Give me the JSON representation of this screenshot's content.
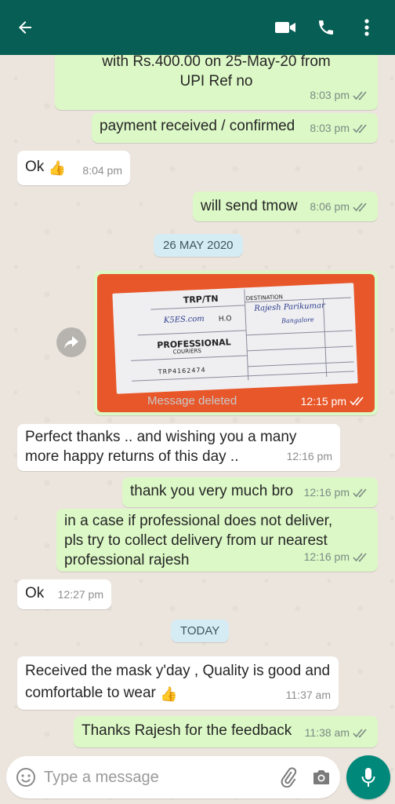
{
  "header": {
    "back_icon": "arrow-left-icon",
    "video_icon": "video-call-icon",
    "call_icon": "phone-icon",
    "menu_icon": "more-vertical-icon",
    "bg_color": "#075e54"
  },
  "messages": {
    "m1": {
      "line1": "with Rs.400.00 on 25-May-20 from",
      "line2": "UPI Ref no",
      "time": "8:03 pm"
    },
    "m2": {
      "text": "payment received / confirmed",
      "time": "8:03 pm"
    },
    "m3": {
      "text": "Ok",
      "emoji": "👍",
      "time": "8:04 pm"
    },
    "m4": {
      "text": "will send tmow",
      "time": "8:06 pm"
    },
    "day1": "26 MAY 2020",
    "m5": {
      "deleted_label": "Message deleted",
      "time": "12:15 pm",
      "receipt": {
        "brand": "PROFESSIONAL",
        "sub": "COURIERS",
        "code": "TRP/TN",
        "dest": "DESTINATION",
        "handwritten_from": "K5ES.com",
        "handwritten_to": "Rajesh Parikumar",
        "city": "Bangalore",
        "ho": "H.O",
        "tracking": "TRP4162474"
      }
    },
    "m6": {
      "line1": "Perfect thanks .. and wishing you a many",
      "line2": "more happy returns of this day ..",
      "time": "12:16 pm"
    },
    "m7": {
      "text": "thank you very much bro",
      "time": "12:16 pm"
    },
    "m8": {
      "line1": "in a case if professional does not deliver,",
      "line2": "pls try to collect delivery from ur nearest",
      "line3": "professional rajesh",
      "time": "12:16 pm"
    },
    "m9": {
      "text": "Ok",
      "time": "12:27 pm"
    },
    "day2": "TODAY",
    "m10": {
      "line1": "Received the mask y'day , Quality is good and",
      "line2": "comfortable to wear",
      "emoji": "👍",
      "time": "11:37 am"
    },
    "m11": {
      "text": "Thanks Rajesh for the feedback",
      "time": "11:38 am"
    }
  },
  "composer": {
    "placeholder": "Type a message",
    "emoji_icon": "emoji-icon",
    "attach_icon": "paperclip-icon",
    "camera_icon": "camera-icon",
    "mic_icon": "microphone-icon"
  },
  "colors": {
    "outgoing": "#dcf8c6",
    "incoming": "#ffffff",
    "read_ticks": "#7b8a84",
    "accent": "#00897b"
  }
}
